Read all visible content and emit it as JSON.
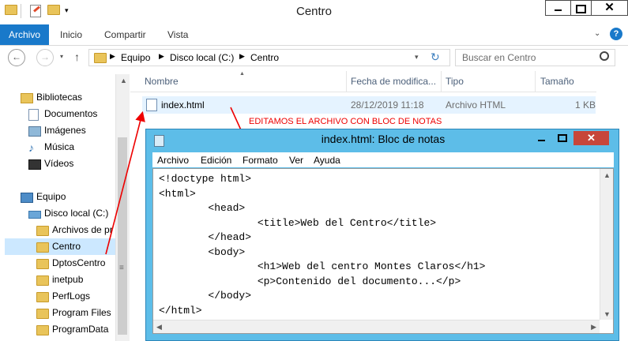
{
  "window": {
    "title": "Centro"
  },
  "ribbon": {
    "tabs": [
      "Archivo",
      "Inicio",
      "Compartir",
      "Vista"
    ]
  },
  "address": {
    "crumbs": [
      "Equipo",
      "Disco local (C:)",
      "Centro"
    ],
    "search_placeholder": "Buscar en Centro"
  },
  "nav": {
    "bibliotecas": "Bibliotecas",
    "libs": [
      "Documentos",
      "Imágenes",
      "Música",
      "Vídeos"
    ],
    "equipo": "Equipo",
    "disco": "Disco local (C:)",
    "folders": [
      "Archivos de pr",
      "Centro",
      "DptosCentro",
      "inetpub",
      "PerfLogs",
      "Program Files (",
      "ProgramData"
    ]
  },
  "filelist": {
    "columns": [
      "Nombre",
      "Fecha de modifica...",
      "Tipo",
      "Tamaño"
    ],
    "rows": [
      {
        "name": "index.html",
        "date": "28/12/2019 11:18",
        "type": "Archivo HTML",
        "size": "1 KB"
      }
    ]
  },
  "annotation": "EDITAMOS EL ARCHIVO CON BLOC DE NOTAS",
  "notepad": {
    "title": "index.html: Bloc de notas",
    "menu": [
      "Archivo",
      "Edición",
      "Formato",
      "Ver",
      "Ayuda"
    ],
    "content": "<!doctype html>\n<html>\n        <head>\n                <title>Web del Centro</title>\n        </head>\n        <body>\n                <h1>Web del centro Montes Claros</h1>\n                <p>Contenido del documento...</p>\n        </body>\n</html>"
  },
  "colors": {
    "accent": "#1979ca",
    "notepad_frame": "#5dbde8",
    "selection": "#cce8ff",
    "annotation": "#e00000"
  }
}
